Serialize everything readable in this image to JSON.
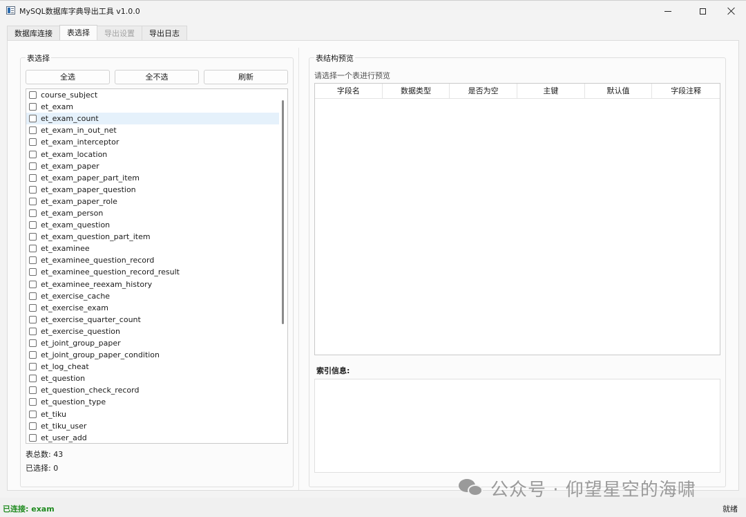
{
  "window": {
    "title": "MySQL数据库字典导出工具 v1.0.0"
  },
  "tabs": [
    {
      "label": "数据库连接"
    },
    {
      "label": "表选择"
    },
    {
      "label": "导出设置"
    },
    {
      "label": "导出日志"
    }
  ],
  "left_panel": {
    "title": "表选择",
    "buttons": {
      "select_all": "全选",
      "select_none": "全不选",
      "refresh": "刷新"
    },
    "tables": [
      "course_subject",
      "et_exam",
      "et_exam_count",
      "et_exam_in_out_net",
      "et_exam_interceptor",
      "et_exam_location",
      "et_exam_paper",
      "et_exam_paper_part_item",
      "et_exam_paper_question",
      "et_exam_paper_role",
      "et_exam_person",
      "et_exam_question",
      "et_exam_question_part_item",
      "et_examinee",
      "et_examinee_question_record",
      "et_examinee_question_record_result",
      "et_examinee_reexam_history",
      "et_exercise_cache",
      "et_exercise_exam",
      "et_exercise_quarter_count",
      "et_exercise_question",
      "et_joint_group_paper",
      "et_joint_group_paper_condition",
      "et_log_cheat",
      "et_question",
      "et_question_check_record",
      "et_question_type",
      "et_tiku",
      "et_tiku_user",
      "et_user_add"
    ],
    "highlighted_table": "et_exam_count",
    "total_label": "表总数: 43",
    "selected_label": "已选择: 0"
  },
  "right_panel": {
    "title": "表结构预览",
    "hint": "请选择一个表进行预览",
    "columns": [
      "字段名",
      "数据类型",
      "是否为空",
      "主键",
      "默认值",
      "字段注释"
    ],
    "index_label": "索引信息:"
  },
  "watermark": "公众号 · 仰望星空的海啸",
  "status": {
    "left": "已连接: exam",
    "right": "就绪",
    "left_color": "#1f8b1f"
  }
}
